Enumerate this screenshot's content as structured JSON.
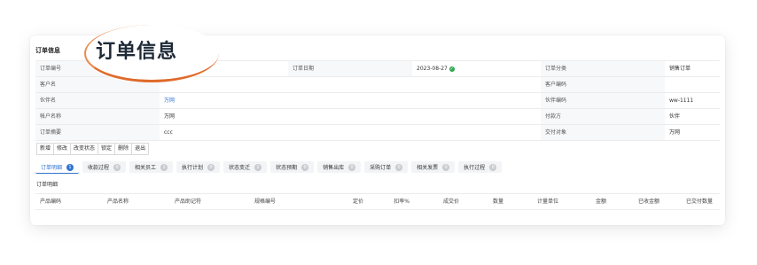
{
  "section_title": "订单信息",
  "callout_text": "订单信息",
  "form": {
    "rows": [
      [
        {
          "label": "订单编号",
          "value": ""
        },
        {
          "label": "订单日期",
          "value": "2023-08-27"
        },
        {
          "label": "订单分类",
          "value": "销售订单"
        }
      ],
      [
        {
          "label": "客户名",
          "value": ""
        },
        {
          "label": "客户编码",
          "value": ""
        }
      ],
      [
        {
          "label": "伙伴名",
          "value": "万网"
        },
        {
          "label": "伙伴编码",
          "value": "ww-1111"
        }
      ],
      [
        {
          "label": "帐户名称",
          "value": "万网"
        },
        {
          "label": "付款方",
          "value": "伙伴"
        }
      ],
      [
        {
          "label": "订单摘要",
          "value": "ccc"
        },
        {
          "label": "交付对象",
          "value": "万网"
        }
      ]
    ]
  },
  "toolbar": [
    "新增",
    "修改",
    "改变状态",
    "锁定",
    "删除",
    "退出"
  ],
  "tabs": [
    {
      "label": "订单明细",
      "badge": "1",
      "active": true
    },
    {
      "label": "收款过程",
      "badge": "0"
    },
    {
      "label": "相关员工",
      "badge": "1"
    },
    {
      "label": "执行计划",
      "badge": "0"
    },
    {
      "label": "状态变迁",
      "badge": "2"
    },
    {
      "label": "状态预期",
      "badge": "0"
    },
    {
      "label": "销售出库",
      "badge": "0"
    },
    {
      "label": "采购订单",
      "badge": "0"
    },
    {
      "label": "相关发票",
      "badge": "0"
    },
    {
      "label": "执行过程",
      "badge": "0"
    }
  ],
  "subtab": "订单明细",
  "table_headers": [
    "产品编码",
    "产品名称",
    "产品助记符",
    "规格编号",
    "定价",
    "扣率%",
    "成交价",
    "数量",
    "计量单位",
    "金额",
    "已收金额",
    "已交付数量"
  ],
  "colors": {
    "accent": "#2f74d0",
    "callout_ring": "#e06a2a",
    "status_ok": "#2ea44f"
  }
}
